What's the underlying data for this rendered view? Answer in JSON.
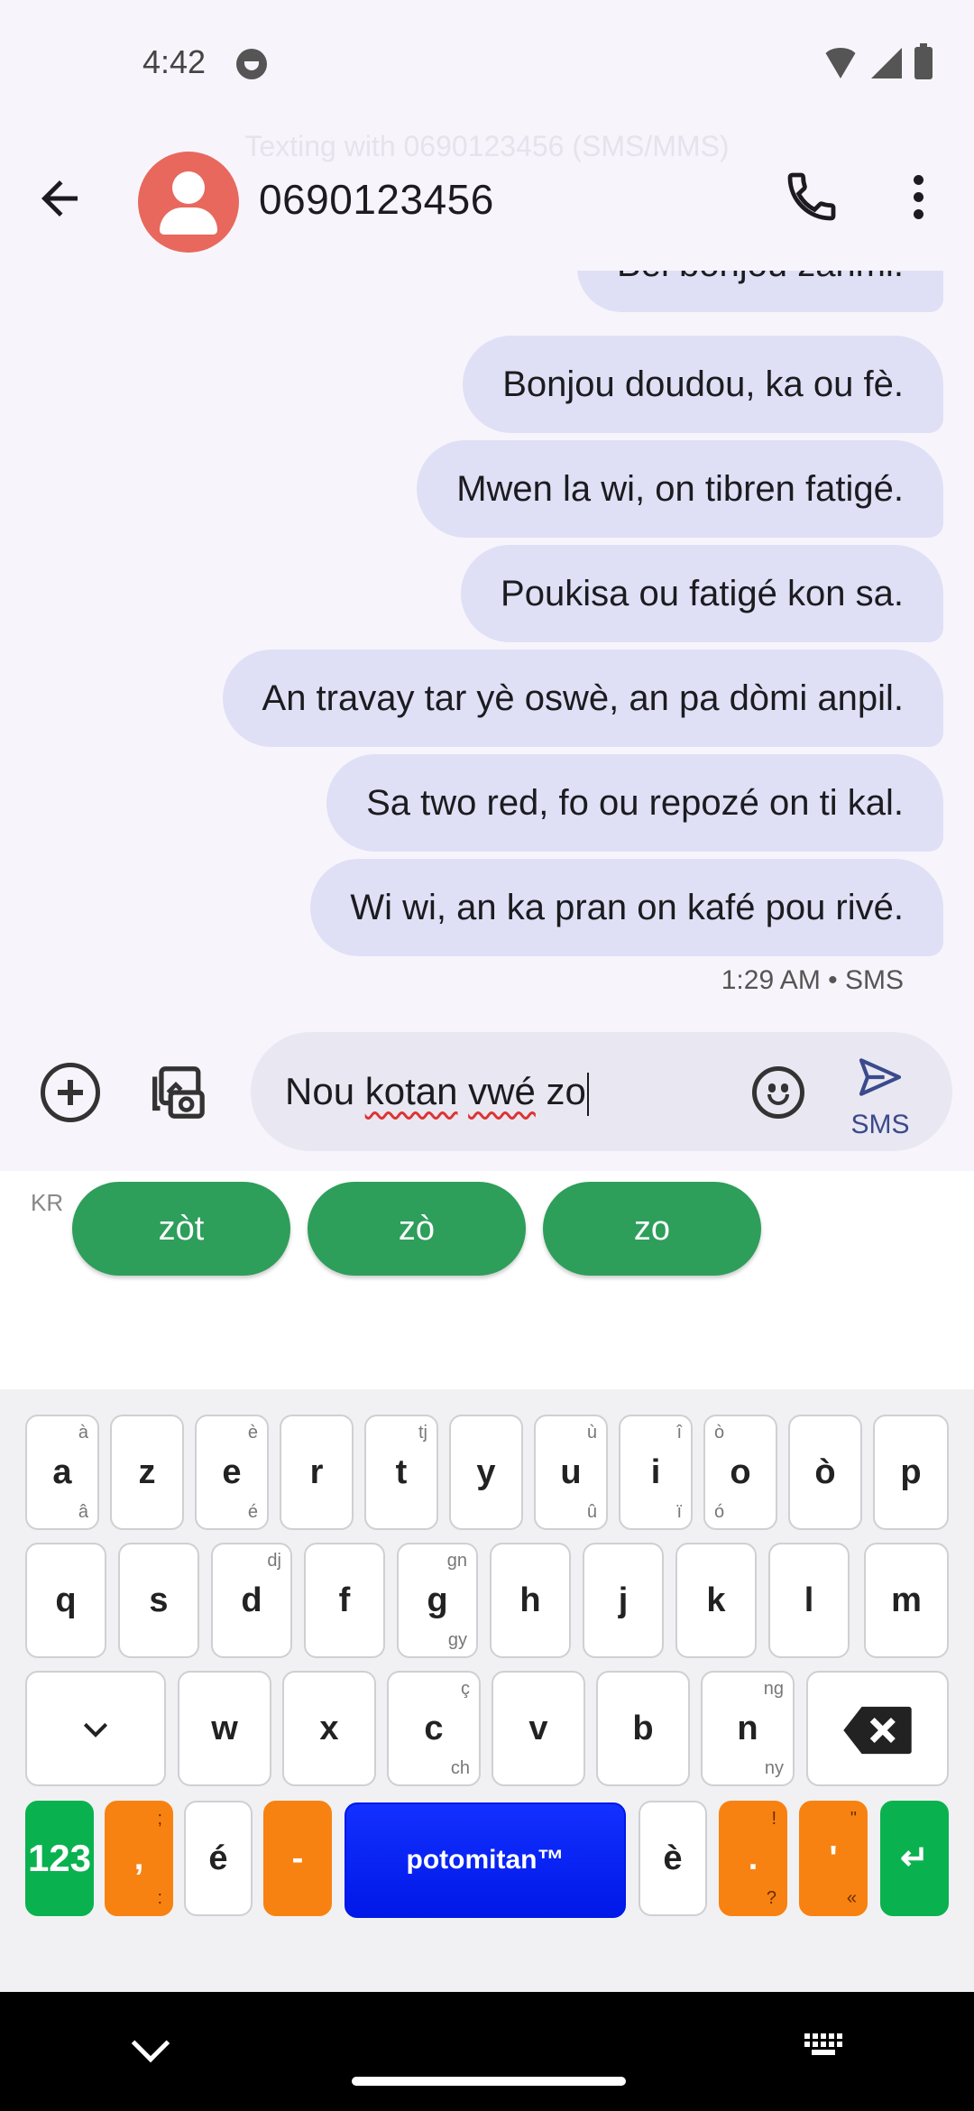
{
  "status_bar": {
    "time": "4:42"
  },
  "banner": "Texting with 0690123456 (SMS/MMS)",
  "app_bar": {
    "contact": "0690123456"
  },
  "messages": [
    {
      "text": "Bel bonjou zanmi."
    },
    {
      "text": "Bonjou doudou, ka ou fè."
    },
    {
      "text": "Mwen la wi, on tibren fatigé."
    },
    {
      "text": "Poukisa ou fatigé kon sa."
    },
    {
      "text": "An travay tar yè oswè, an pa dòmi anpil."
    },
    {
      "text": "Sa two red, fo ou repozé on ti kal."
    },
    {
      "text": "Wi wi, an ka pran on kafé pou rivé."
    }
  ],
  "message_meta": "1:29 AM • SMS",
  "compose": {
    "word1": "Nou ",
    "word2": "kotan",
    "sep1": " ",
    "word3": "vwé",
    "word4": " zo",
    "send_label": "SMS"
  },
  "suggestions": {
    "lang": "KR",
    "chips": [
      "zòt",
      "zò",
      "zo"
    ]
  },
  "keyboard": {
    "row1": [
      {
        "label": "a",
        "top": "à",
        "bottom": "â"
      },
      {
        "label": "z"
      },
      {
        "label": "e",
        "top": "è",
        "bottom": "é"
      },
      {
        "label": "r"
      },
      {
        "label": "t",
        "top": "tj"
      },
      {
        "label": "y"
      },
      {
        "label": "u",
        "top": "ù",
        "bottom": "û"
      },
      {
        "label": "i",
        "top": "î",
        "bottom": "ï"
      },
      {
        "label": "o",
        "top_left": "ò",
        "bottom_left": "ó"
      },
      {
        "label": "ò"
      },
      {
        "label": "p"
      }
    ],
    "row2": [
      {
        "label": "q"
      },
      {
        "label": "s"
      },
      {
        "label": "d",
        "top": "dj"
      },
      {
        "label": "f"
      },
      {
        "label": "g",
        "top": "gn",
        "bottom": "gy"
      },
      {
        "label": "h"
      },
      {
        "label": "j"
      },
      {
        "label": "k"
      },
      {
        "label": "l"
      },
      {
        "label": "m"
      }
    ],
    "row3": [
      {
        "label": "w"
      },
      {
        "label": "x"
      },
      {
        "label": "c",
        "top": "ç",
        "bottom": "ch"
      },
      {
        "label": "v"
      },
      {
        "label": "b"
      },
      {
        "label": "n",
        "top": "ng",
        "bottom": "ny"
      }
    ],
    "row4": {
      "numbers": "123",
      "comma": ",",
      "comma_top": ";",
      "comma_bottom": ":",
      "e_acute": "é",
      "dash": "-",
      "space": "potomitan™",
      "e_grave": "è",
      "period": ".",
      "period_top": "!",
      "period_bottom": "?",
      "apostrophe": "'",
      "apostrophe_top": "\"",
      "apostrophe_bottom": "«",
      "enter": "↵"
    }
  },
  "colors": {
    "bubble": "#dfe0f6",
    "avatar": "#e8685d",
    "chip": "#2e9e5b",
    "key_orange": "#f88211",
    "key_green": "#09b24f",
    "key_blue": "#1230ff"
  }
}
